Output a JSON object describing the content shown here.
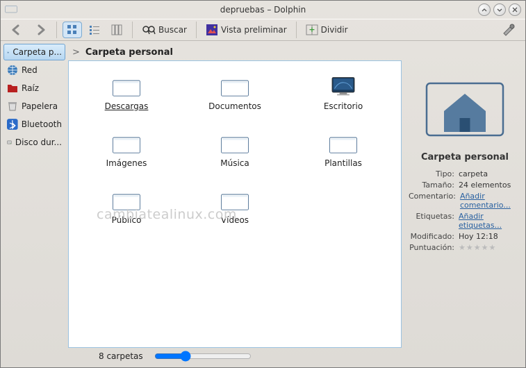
{
  "window": {
    "title": "depruebas – Dolphin"
  },
  "toolbar": {
    "buscar": "Buscar",
    "vista_preliminar": "Vista preliminar",
    "dividir": "Dividir"
  },
  "sidebar": {
    "items": [
      {
        "label": "Carpeta p...",
        "icon": "home-folder",
        "sel": true
      },
      {
        "label": "Red",
        "icon": "globe"
      },
      {
        "label": "Raíz",
        "icon": "red-folder"
      },
      {
        "label": "Papelera",
        "icon": "trash"
      },
      {
        "label": "Bluetooth",
        "icon": "bluetooth"
      },
      {
        "label": "Disco dur...",
        "icon": "disk"
      }
    ]
  },
  "breadcrumb": {
    "current": "Carpeta personal",
    "arrow": ">"
  },
  "files": [
    {
      "label": "Descargas",
      "icon": "folder",
      "underline": true
    },
    {
      "label": "Documentos",
      "icon": "folder"
    },
    {
      "label": "Escritorio",
      "icon": "desktop"
    },
    {
      "label": "Imágenes",
      "icon": "folder"
    },
    {
      "label": "Música",
      "icon": "folder"
    },
    {
      "label": "Plantillas",
      "icon": "folder"
    },
    {
      "label": "Público",
      "icon": "folder"
    },
    {
      "label": "Vídeos",
      "icon": "folder"
    }
  ],
  "watermark": "cambiatealinux.com",
  "status": {
    "count": "8 carpetas"
  },
  "info": {
    "title": "Carpeta personal",
    "rows": [
      {
        "k": "Tipo:",
        "v": "carpeta"
      },
      {
        "k": "Tamaño:",
        "v": "24 elementos"
      },
      {
        "k": "Comentario:",
        "v": "Añadir comentario...",
        "link": true
      },
      {
        "k": "Etiquetas:",
        "v": "Añadir etiquetas...",
        "link": true
      },
      {
        "k": "Modificado:",
        "v": "Hoy 12:18"
      },
      {
        "k": "Puntuación:",
        "v": "★★★★★",
        "stars": true
      }
    ]
  }
}
